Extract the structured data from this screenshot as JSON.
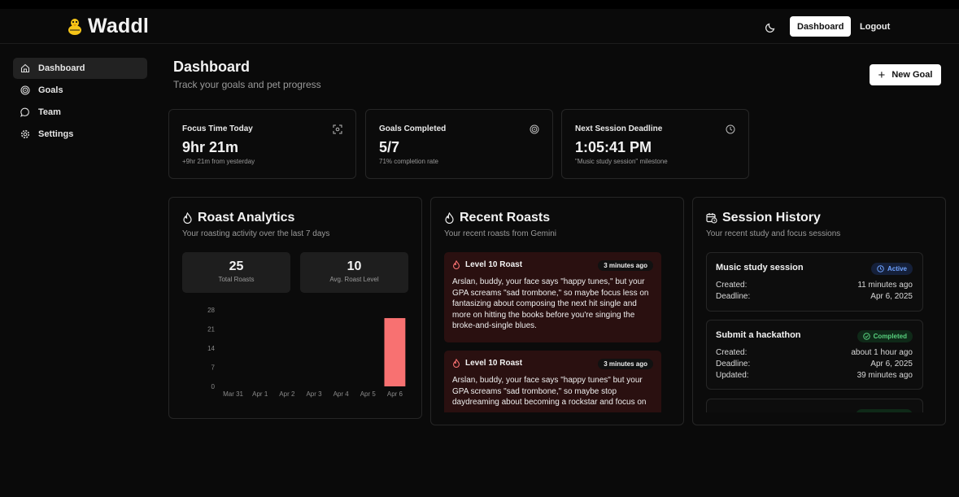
{
  "app": {
    "name": "Waddl"
  },
  "header": {
    "dashboard_label": "Dashboard",
    "logout_label": "Logout"
  },
  "sidebar": {
    "items": [
      {
        "label": "Dashboard",
        "icon": "home-icon",
        "active": true
      },
      {
        "label": "Goals",
        "icon": "target-icon"
      },
      {
        "label": "Team",
        "icon": "chat-icon"
      },
      {
        "label": "Settings",
        "icon": "gear-icon"
      }
    ]
  },
  "page": {
    "title": "Dashboard",
    "subtitle": "Track your goals and pet progress",
    "new_goal_label": "New Goal"
  },
  "stats": [
    {
      "label": "Focus Time Today",
      "value": "9hr 21m",
      "note": "+9hr 21m from yesterday",
      "icon": "focus-icon"
    },
    {
      "label": "Goals Completed",
      "value": "5/7",
      "note": "71% completion rate",
      "icon": "target-icon"
    },
    {
      "label": "Next Session Deadline",
      "value": "1:05:41 PM",
      "note": "\"Music study session\" milestone",
      "icon": "clock-icon"
    }
  ],
  "roast_analytics": {
    "title": "Roast Analytics",
    "subtitle": "Your roasting activity over the last 7 days",
    "total_roasts": "25",
    "total_roasts_label": "Total Roasts",
    "avg_level": "10",
    "avg_level_label": "Avg. Roast Level"
  },
  "chart_data": {
    "type": "bar",
    "categories": [
      "Mar 31",
      "Apr 1",
      "Apr 2",
      "Apr 3",
      "Apr 4",
      "Apr 5",
      "Apr 6"
    ],
    "values": [
      0,
      0,
      0,
      0,
      0,
      0,
      25
    ],
    "yticks": [
      "28",
      "21",
      "14",
      "7",
      "0"
    ],
    "ylim": [
      0,
      28
    ],
    "bar_color": "#f87171"
  },
  "recent_roasts": {
    "title": "Recent Roasts",
    "subtitle": "Your recent roasts from Gemini",
    "items": [
      {
        "level": "Level 10 Roast",
        "time": "3 minutes ago",
        "text": "Arslan, buddy, your face says \"happy tunes,\" but your GPA screams \"sad trombone,\" so maybe focus less on fantasizing about composing the next hit single and more on hitting the books before you're singing the broke-and-single blues."
      },
      {
        "level": "Level 10 Roast",
        "time": "3 minutes ago",
        "text": "Arslan, buddy, your face says \"happy tunes\" but your GPA screams \"sad trombone,\" so maybe stop daydreaming about becoming a rockstar and focus on"
      }
    ]
  },
  "session_history": {
    "title": "Session History",
    "subtitle": "Your recent study and focus sessions",
    "items": [
      {
        "title": "Music study session",
        "status": "Active",
        "rows": [
          {
            "k": "Created:",
            "v": "11 minutes ago"
          },
          {
            "k": "Deadline:",
            "v": "Apr 6, 2025"
          }
        ]
      },
      {
        "title": "Submit a hackathon",
        "status": "Completed",
        "rows": [
          {
            "k": "Created:",
            "v": "about 1 hour ago"
          },
          {
            "k": "Deadline:",
            "v": "Apr 6, 2025"
          },
          {
            "k": "Updated:",
            "v": "39 minutes ago"
          }
        ]
      }
    ]
  },
  "colors": {
    "accent_red": "#f87171",
    "badge_active": "#6ea2ff",
    "badge_completed": "#58d17e",
    "logo_yellow": "#f5c518"
  }
}
